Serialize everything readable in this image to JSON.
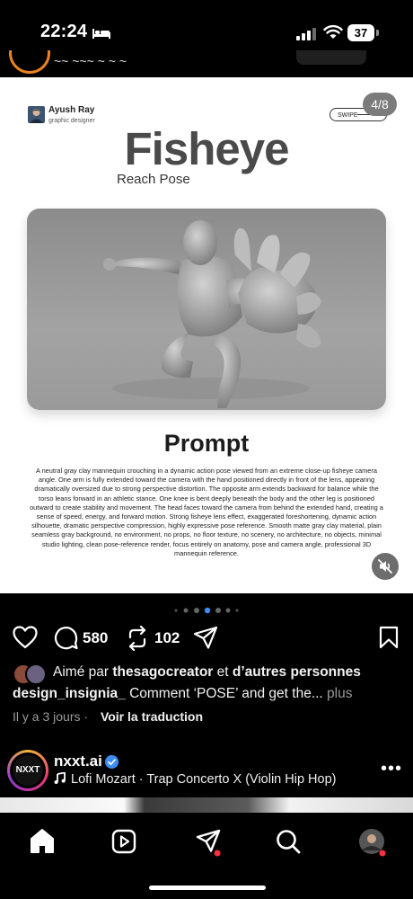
{
  "status_bar": {
    "time": "22:24",
    "battery": "37"
  },
  "previous_post": {
    "text": "~~ ~~~ ~ ~ ~"
  },
  "slide": {
    "author_name": "Ayush Ray",
    "author_role": "graphic designer",
    "swipe_label": "SWIPE",
    "page_indicator": "4/8",
    "title": "Fisheye",
    "subtitle": "Reach Pose",
    "prompt_heading": "Prompt",
    "prompt_text": "A neutral gray clay mannequin crouching in a dynamic action pose viewed from an extreme close-up fisheye camera angle. One arm is fully extended toward the camera with the hand positioned directly in front of the lens, appearing dramatically oversized due to strong perspective distortion. The opposite arm extends backward for balance while the torso leans forward in an athletic stance. One knee is bent deeply beneath the body and the other leg is positioned outward to create stability and movement. The head faces toward the camera from behind the extended hand, creating a sense of speed, energy, and forward motion. Strong fisheye lens effect, exaggerated foreshortening, dynamic action silhouette, dramatic perspective compression, highly expressive pose reference. Smooth matte gray clay material, plain seamless gray background, no environment, no props, no floor texture, no scenery, no architecture, no objects, minimal studio lighting, clean pose-reference render, focus entirely on anatomy, pose and camera angle, professional 3D mannequin reference."
  },
  "carousel": {
    "total_dots": 7,
    "active_index": 3
  },
  "actions": {
    "comments_count": "580",
    "reposts_count": "102"
  },
  "likes": {
    "prefix": "Aimé par ",
    "user": "thesagocreator",
    "middle": " et ",
    "others": "d’autres personnes"
  },
  "caption": {
    "username": "design_insignia_",
    "text": " Comment ‘POSE’ and get the...",
    "more": " plus"
  },
  "meta": {
    "time_ago": "Il y a 3 jours",
    "separator": " · ",
    "translate": "Voir la traduction"
  },
  "next_post": {
    "avatar_text": "NXXT",
    "username": "nxxt.ai",
    "music": "Lofi Mozart · Trap Concerto X (Violin Hip Hop)"
  },
  "colors": {
    "accent_verified": "#3d8cf2",
    "notification_dot": "#ff3040",
    "carousel_active": "#3d8cf2"
  }
}
